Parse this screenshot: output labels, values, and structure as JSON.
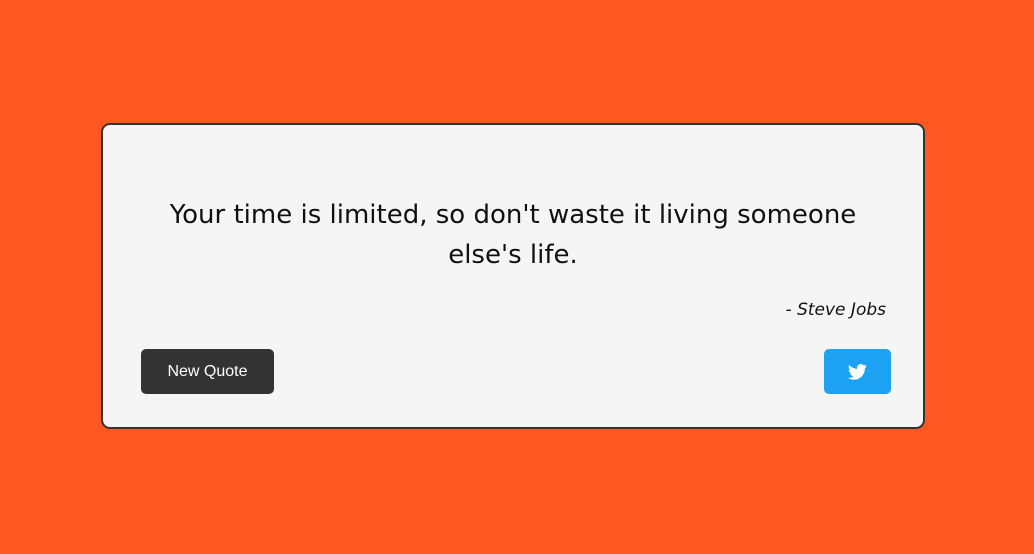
{
  "quote": {
    "text": "Your time is limited, so don't waste it living someone else's life.",
    "author": "- Steve Jobs"
  },
  "actions": {
    "new_quote_label": "New Quote",
    "tweet_icon": "twitter-icon"
  },
  "colors": {
    "page_background": "#FF5722",
    "card_background": "#F5F5F5",
    "card_border": "#333333",
    "new_quote_button": "#333333",
    "tweet_button": "#1DA1F2"
  }
}
